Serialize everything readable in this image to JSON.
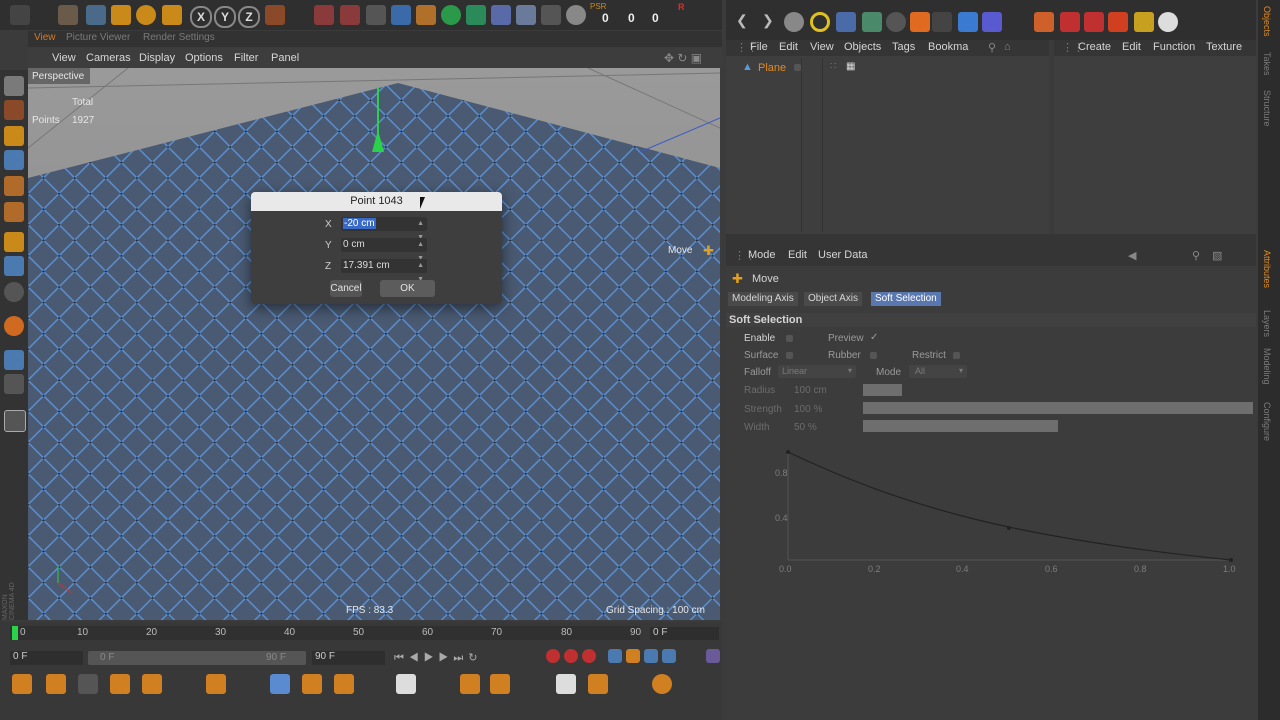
{
  "viewport": {
    "tabs": [
      "View",
      "Picture Viewer",
      "Render Settings"
    ],
    "menu": [
      "View",
      "Cameras",
      "Display",
      "Options",
      "Filter",
      "Panel"
    ],
    "label": "Perspective",
    "stats": {
      "total_label": "Total",
      "points_label": "Points",
      "points_value": "1927"
    },
    "move_label": "Move",
    "fps": "FPS : 83.3",
    "grid": "Grid Spacing : 100 cm"
  },
  "dialog": {
    "title": "Point 1043",
    "x_label": "X",
    "x_value": "-20 cm",
    "y_label": "Y",
    "y_value": "0 cm",
    "z_label": "Z",
    "z_value": "17.391 cm",
    "cancel": "Cancel",
    "ok": "OK"
  },
  "timeline": {
    "ticks": [
      "0",
      "10",
      "20",
      "30",
      "40",
      "50",
      "60",
      "70",
      "80",
      "90"
    ],
    "current_frame": "0 F",
    "start": "0 F",
    "range_start": "0 F",
    "range_end": "90 F",
    "end": "90 F"
  },
  "objects": {
    "menu": [
      "File",
      "Edit",
      "View",
      "Objects",
      "Tags",
      "Bookma"
    ],
    "item": "Plane"
  },
  "materials": {
    "menu": [
      "Create",
      "Edit",
      "Function",
      "Texture"
    ]
  },
  "attributes": {
    "menu": [
      "Mode",
      "Edit",
      "User Data"
    ],
    "tool": "Move",
    "tabs": [
      "Modeling Axis",
      "Object Axis",
      "Soft Selection"
    ],
    "section": "Soft Selection",
    "enable": "Enable",
    "preview": "Preview",
    "preview_check": "✓",
    "surface": "Surface",
    "rubber": "Rubber",
    "restrict": "Restrict",
    "falloff_label": "Falloff",
    "falloff_value": "Linear",
    "mode_label": "Mode",
    "mode_value": "All",
    "radius_label": "Radius",
    "radius_value": "100 cm",
    "strength_label": "Strength",
    "strength_value": "100 %",
    "width_label": "Width",
    "width_value": "50 %",
    "graph_y": [
      "0.8",
      "0.4"
    ],
    "graph_x": [
      "0.0",
      "0.2",
      "0.4",
      "0.6",
      "0.8",
      "1.0"
    ]
  },
  "toolbar": {
    "axis_x": "X",
    "axis_y": "Y",
    "axis_z": "Z",
    "psr": "PSR",
    "counter_0": "0",
    "counter_1": "0",
    "counter_2": "0",
    "r_label": "R"
  },
  "side_tabs": [
    "Objects",
    "Takes",
    "Structure",
    "Attributes",
    "Layers",
    "Modeling",
    "Configure"
  ],
  "brand": "MAXON CINEMA 4D"
}
